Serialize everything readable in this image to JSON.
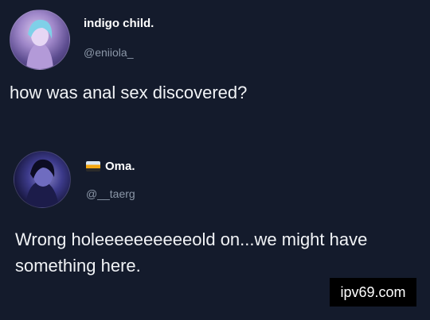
{
  "tweets": [
    {
      "display_name": "indigo child.",
      "handle": "@eniiola_",
      "text": "how was anal sex discovered?"
    },
    {
      "display_name": "Oma.",
      "name_icon": "sunset-flag-icon",
      "handle": "@__taerg",
      "text": "Wrong holeeeeeeeeeeold on...we might have something here."
    }
  ],
  "watermark": "ipv69.com",
  "colors": {
    "background": "#141b2c",
    "handle": "#8b97a8",
    "text": "#f1f3f6"
  }
}
